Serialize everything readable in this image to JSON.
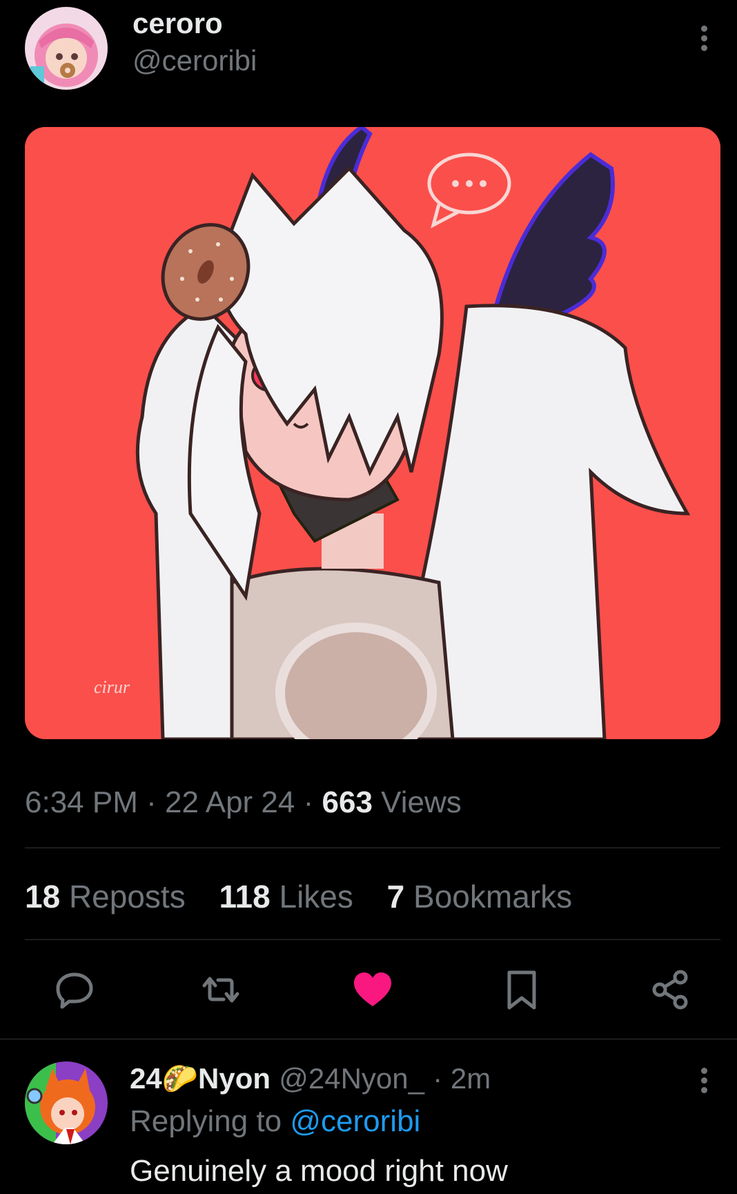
{
  "tweet": {
    "author_name": "ceroro",
    "author_handle": "@ceroribi",
    "time": "6:34 PM",
    "date": "22 Apr 24",
    "views_count": "663",
    "views_label": "Views",
    "separator": "·",
    "stats": {
      "reposts_count": "18",
      "reposts_label": "Reposts",
      "likes_count": "118",
      "likes_label": "Likes",
      "bookmarks_count": "7",
      "bookmarks_label": "Bookmarks"
    },
    "image_signature": "cirur"
  },
  "reply": {
    "author_name": "24🌮Nyon",
    "author_handle": "@24Nyon_",
    "age": "· 2m",
    "replying_prefix": "Replying to",
    "replying_handle": "@ceroribi",
    "text": "Genuinely a mood right now"
  },
  "icons": {
    "reply": "speech-bubble-icon",
    "repost": "repost-arrows-icon",
    "like": "heart-filled-icon",
    "bookmark": "bookmark-icon",
    "share": "share-nodes-icon",
    "more": "vertical-dots-icon"
  },
  "colors": {
    "background": "#000000",
    "text_primary": "#e7e9ea",
    "text_secondary": "#71767b",
    "like_active": "#f91880",
    "link": "#1d9bf0",
    "art_background": "#fb4f4b"
  }
}
